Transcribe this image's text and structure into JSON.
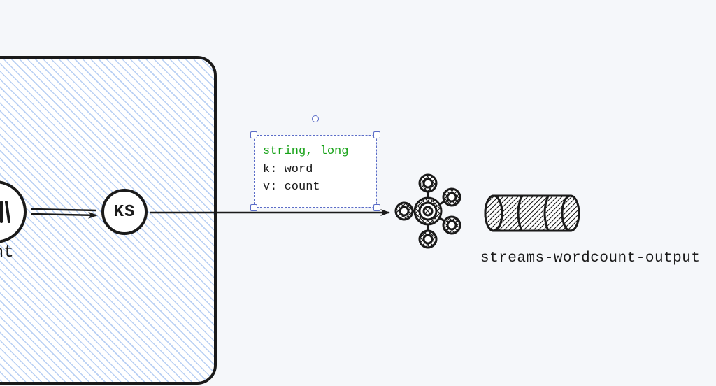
{
  "container": {
    "hatch_angle": 45
  },
  "node_count": {
    "glyph": "𝄐|",
    "label": "ount"
  },
  "node_ks": {
    "label": "KS"
  },
  "selected_textbox": {
    "types": "string, long",
    "line_k": "k: word",
    "line_v": "v: count"
  },
  "output_topic": {
    "label": "streams-wordcount-output"
  },
  "icons": {
    "kafka_cluster": "kafka-cluster-icon",
    "topic_cylinder": "topic-cylinder-icon"
  },
  "colors": {
    "selection": "#5a6cc7",
    "type_text": "#19a319",
    "stroke": "#1a1a1a",
    "hatch": "#6a96e0",
    "bg": "#f5f7fa"
  }
}
